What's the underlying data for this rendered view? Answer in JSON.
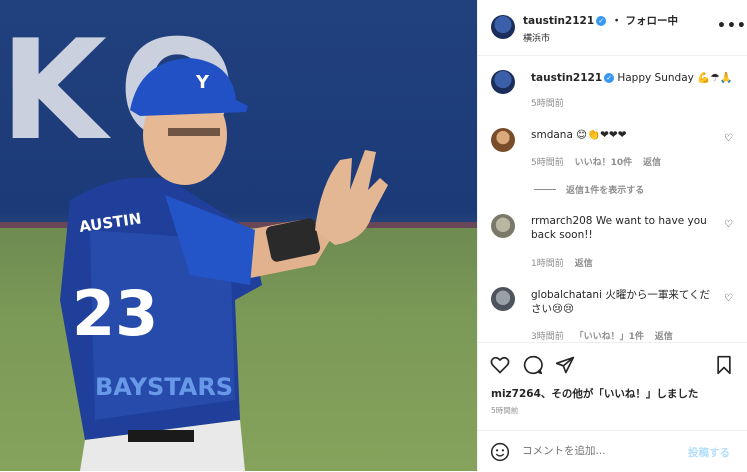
{
  "header": {
    "username": "taustin2121",
    "follow_status": "・ フォロー中",
    "location": "横浜市",
    "more_icon": "more-horizontal-icon"
  },
  "caption": {
    "username": "taustin2121",
    "text": "Happy Sunday 💪☂🙏",
    "time": "5時間前"
  },
  "comments": [
    {
      "username": "smdana",
      "text": "😊👏❤❤❤",
      "time": "5時間前",
      "likes": "いいね！10件",
      "reply": "返信",
      "view_replies": "返信1件を表示する"
    },
    {
      "username": "rrmarch208",
      "text": "We want to have you back soon!!",
      "time": "1時間前",
      "reply": "返信"
    },
    {
      "username": "globalchatani",
      "text": "火曜から一軍来てください😢😢",
      "time": "3時間前",
      "likes": "「いいね！」1件",
      "reply": "返信"
    }
  ],
  "likes_line": "miz7264、その他が「いいね！」しました",
  "post_time": "5時間前",
  "comment_box": {
    "placeholder": "コメントを追加...",
    "post_label": "投稿する"
  },
  "photo": {
    "background_text": "KO",
    "jersey_name": "AUSTIN",
    "jersey_number": "23",
    "jersey_script": "BAYSTARS"
  },
  "colors": {
    "accent_blue": "#0095f6",
    "verified": "#3897f0",
    "muted": "#8e8e8e"
  }
}
